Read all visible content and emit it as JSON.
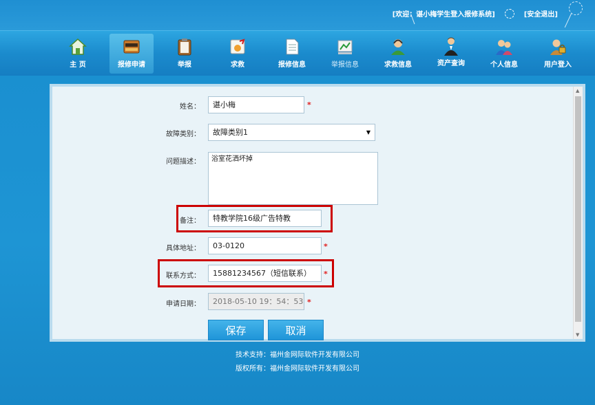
{
  "header": {
    "welcome": "[欢迎：谌小梅学生登入报修系统]",
    "logout": "[安全退出]"
  },
  "nav": {
    "items": [
      {
        "label": "主  页",
        "icon": "home-icon"
      },
      {
        "label": "报修申请",
        "icon": "repair-form-icon"
      },
      {
        "label": "举报",
        "icon": "clipboard-icon"
      },
      {
        "label": "求救",
        "icon": "help-icon"
      },
      {
        "label": "报修信息",
        "icon": "document-icon"
      },
      {
        "label": "举报信息",
        "icon": "report-info-icon"
      },
      {
        "label": "求救信息",
        "icon": "support-person-icon"
      },
      {
        "label": "资产查询",
        "icon": "asset-person-icon"
      },
      {
        "label": "个人信息",
        "icon": "users-icon"
      },
      {
        "label": "用户登入",
        "icon": "login-lock-icon"
      }
    ]
  },
  "form": {
    "name_label": "姓名：",
    "name_value": "谌小梅",
    "fault_label": "故障类别：",
    "fault_value": "故障类别1",
    "desc_label": "问题描述：",
    "desc_value": "浴室花洒坏掉",
    "remark_label": "备注：",
    "remark_value": "特教学院16级广告特教",
    "address_label": "具体地址：",
    "address_value": "03-0120",
    "contact_label": "联系方式：",
    "contact_value": "15881234567（短信联系）",
    "date_label": "申请日期：",
    "date_value": "2018-05-10  19：54：53",
    "required_mark": "*"
  },
  "buttons": {
    "save": "保存",
    "cancel": "取消"
  },
  "footer": {
    "support": "技术支持：福州金网际软件开发有限公司",
    "copyright": "版权所有：福州金网际软件开发有限公司"
  },
  "colors": {
    "accent": "#1f94d8",
    "highlight": "#cc0000",
    "required": "#e02020"
  }
}
